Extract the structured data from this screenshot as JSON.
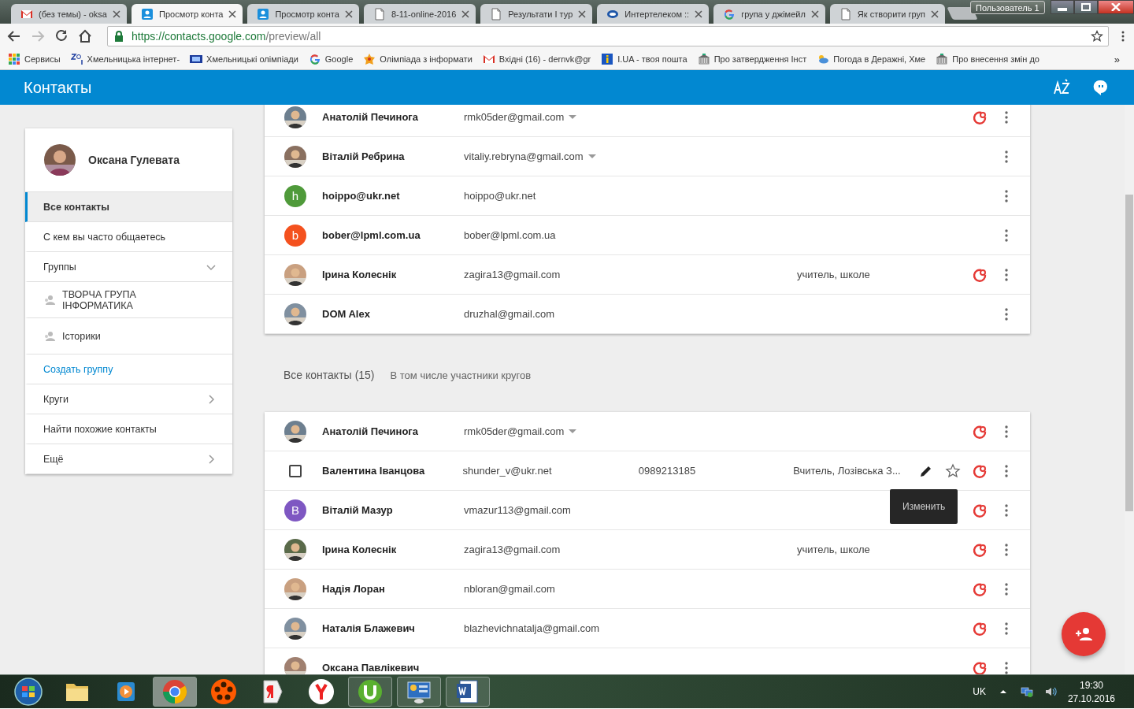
{
  "browser": {
    "tabs": [
      {
        "title": "(без темы) - oksa",
        "selected": false
      },
      {
        "title": "Просмотр конта",
        "selected": true
      },
      {
        "title": "Просмотр конта",
        "selected": false
      },
      {
        "title": "8-11-online-2016",
        "selected": false
      },
      {
        "title": "Результати I тур",
        "selected": false
      },
      {
        "title": "Интертелеком ::",
        "selected": false
      },
      {
        "title": "група у джімейл",
        "selected": false
      },
      {
        "title": "Як створити груп",
        "selected": false
      }
    ],
    "profile": "Пользователь 1",
    "url_host": "https://contacts.google.com",
    "url_path": "/preview/all",
    "bookmarks": [
      {
        "label": "Сервисы"
      },
      {
        "label": "Хмельницька інтернет-"
      },
      {
        "label": "Хмельницькі олімпіади"
      },
      {
        "label": "Google"
      },
      {
        "label": "Олімпіада з інформати"
      },
      {
        "label": "Вхідні (16) - dernvk@gr"
      },
      {
        "label": "I.UA - твоя пошта"
      },
      {
        "label": "Про затвердження Інст"
      },
      {
        "label": "Погода в Деражні, Хме"
      },
      {
        "label": "Про внесення змін до"
      }
    ],
    "more": "»"
  },
  "app": {
    "title": "Контакты"
  },
  "sidebar": {
    "user": "Оксана Гулевата",
    "items": [
      {
        "label": "Все контакты",
        "kind": "nav",
        "selected": true
      },
      {
        "label": "С кем вы часто общаетесь",
        "kind": "nav",
        "selected": false
      },
      {
        "label": "Группы",
        "kind": "section",
        "expanded": true,
        "selected": false
      },
      {
        "label": "ТВОРЧА ГРУПА ІНФОРМАТИКА",
        "kind": "group",
        "selected": false
      },
      {
        "label": "Історики",
        "kind": "group",
        "selected": false
      },
      {
        "label": "Создать группу",
        "kind": "link",
        "selected": false
      },
      {
        "label": "Круги",
        "kind": "section",
        "expanded": false,
        "selected": false
      },
      {
        "label": "Найти похожие контакты",
        "kind": "nav",
        "selected": false
      },
      {
        "label": "Ещё",
        "kind": "section",
        "expanded": false,
        "selected": false
      }
    ]
  },
  "frequent": {
    "rows": [
      {
        "name": "Анатолій Печинога",
        "email": "rmk05der@gmail.com",
        "dropdown": true,
        "circles": true
      },
      {
        "name": "Віталій Ребрина",
        "email": "vitaliy.rebryna@gmail.com",
        "dropdown": true,
        "circles": false
      },
      {
        "kind": "letter",
        "letter": "h",
        "color": "#4f9a3a",
        "name": "hoippo@ukr.net",
        "email": "hoippo@ukr.net",
        "dropdown": false,
        "circles": false
      },
      {
        "kind": "letter",
        "letter": "b",
        "color": "#f4511e",
        "name": "bober@lpml.com.ua",
        "email": "bober@lpml.com.ua",
        "dropdown": false,
        "circles": false
      },
      {
        "name": "Ірина Колеснік",
        "email": "zagira13@gmail.com",
        "note": "учитель, школе",
        "dropdown": false,
        "circles": true
      },
      {
        "name": "DOM Alex",
        "email": "druzhal@gmail.com",
        "dropdown": false,
        "circles": false
      }
    ]
  },
  "all_contacts": {
    "title": "Все контакты",
    "count": "(15)",
    "subtitle": "В том числе участники кругов",
    "rows": [
      {
        "name": "Анатолій Печинога",
        "email": "rmk05der@gmail.com",
        "dropdown": true,
        "circles": true,
        "hovered": false
      },
      {
        "kind": "checkbox",
        "checked": false,
        "name": "Валентина Іванцова",
        "email": "shunder_v@ukr.net",
        "phone": "0989213185",
        "note": "Вчитель, Лозівська З...",
        "dropdown": false,
        "circles": true,
        "hovered": true,
        "tooltip": "Изменить"
      },
      {
        "kind": "letter",
        "letter": "B",
        "color": "#7e57c2",
        "name": "Віталій Мазур",
        "email": "vmazur113@gmail.com",
        "dropdown": false,
        "circles": true,
        "hovered": false
      },
      {
        "name": "Ірина Колеснік",
        "email": "zagira13@gmail.com",
        "note": "учитель, школе",
        "dropdown": false,
        "circles": true,
        "hovered": false
      },
      {
        "name": "Надія Лоран",
        "email": "nbloran@gmail.com",
        "dropdown": false,
        "circles": true,
        "hovered": false
      },
      {
        "name": "Наталія Блажевич",
        "email": "blazhevichnatalja@gmail.com",
        "dropdown": false,
        "circles": true,
        "hovered": false
      },
      {
        "name": "Оксана Павлікевич",
        "dropdown": false,
        "circles": true,
        "hovered": false
      }
    ]
  },
  "taskbar": {
    "apps": [
      {
        "running": false,
        "selected": false
      },
      {
        "running": false,
        "selected": false
      },
      {
        "running": false,
        "selected": false
      },
      {
        "running": true,
        "selected": true
      },
      {
        "running": false,
        "selected": false
      },
      {
        "running": false,
        "selected": false
      },
      {
        "running": false,
        "selected": false
      },
      {
        "running": true,
        "selected": false
      },
      {
        "running": true,
        "selected": false
      },
      {
        "running": true,
        "selected": false
      }
    ],
    "language": "UK",
    "time": "19:30",
    "date": "27.10.2016"
  }
}
